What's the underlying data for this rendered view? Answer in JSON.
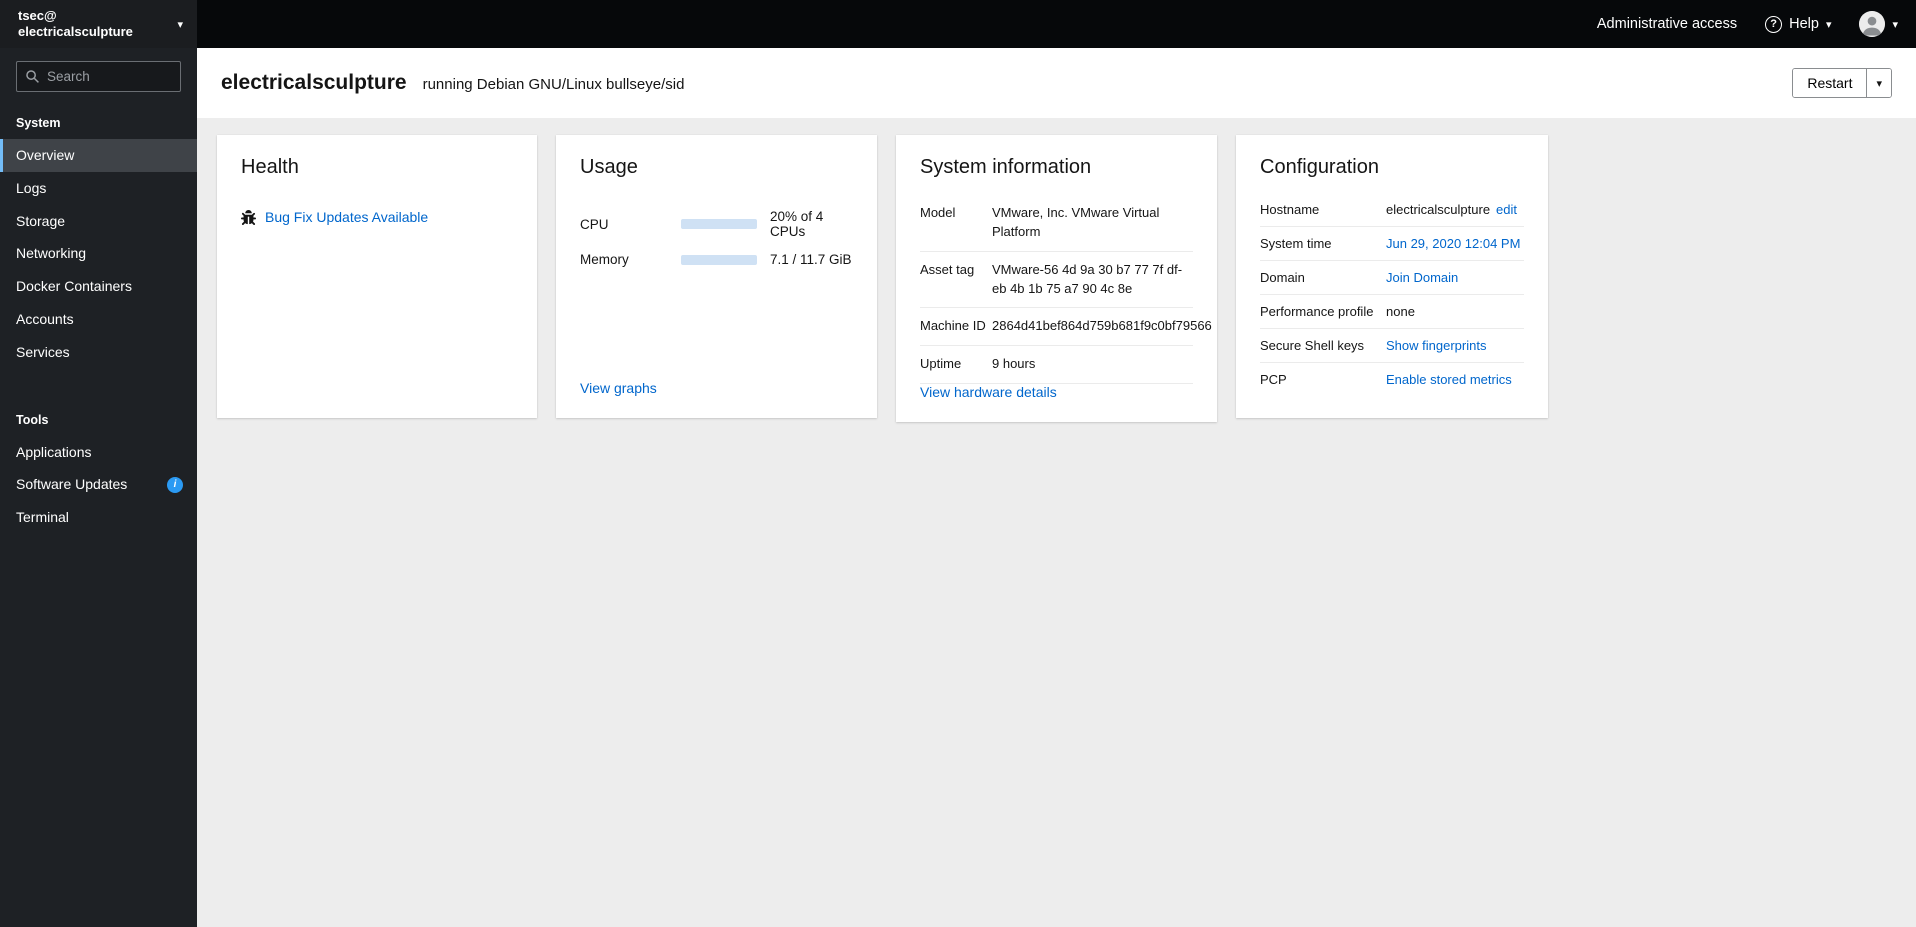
{
  "icons": {
    "chevron_down": "▾",
    "question": "?",
    "info": "i"
  },
  "sidebar": {
    "user_line1": "tsec@",
    "user_line2": "electricalsculpture",
    "search_placeholder": "Search",
    "sections": [
      {
        "label": "System",
        "items": [
          "Overview",
          "Logs",
          "Storage",
          "Networking",
          "Docker Containers",
          "Accounts",
          "Services"
        ]
      },
      {
        "label": "Tools",
        "items": [
          "Applications",
          "Software Updates",
          "Terminal"
        ]
      }
    ]
  },
  "masthead": {
    "admin_access": "Administrative access",
    "help_label": "Help"
  },
  "header": {
    "hostname": "electricalsculpture",
    "os_text": "running Debian GNU/Linux bullseye/sid",
    "restart_label": "Restart"
  },
  "cards": {
    "health": {
      "title": "Health",
      "update_link": "Bug Fix Updates Available"
    },
    "usage": {
      "title": "Usage",
      "cpu_label": "CPU",
      "cpu_value": "20% of 4 CPUs",
      "cpu_bar_style": "width:20%",
      "memory_label": "Memory",
      "memory_value": "7.1 / 11.7 GiB",
      "memory_bar_style": "width:61%",
      "view_graphs_link": "View graphs"
    },
    "system_information": {
      "title": "System information",
      "rows": [
        {
          "label": "Model",
          "value": "VMware, Inc. VMware Virtual Platform"
        },
        {
          "label": "Asset tag",
          "value": "VMware-56 4d 9a 30 b7 77 7f df-eb 4b 1b 75 a7 90 4c 8e"
        },
        {
          "label": "Machine ID",
          "value": "2864d41bef864d759b681f9c0bf79566"
        },
        {
          "label": "Uptime",
          "value": "9 hours"
        }
      ],
      "details_link": "View hardware details"
    },
    "configuration": {
      "title": "Configuration",
      "rows": [
        {
          "label": "Hostname",
          "value": "electricalsculpture",
          "link": "edit"
        },
        {
          "label": "System time",
          "link": "Jun 29, 2020 12:04 PM"
        },
        {
          "label": "Domain",
          "link": "Join Domain"
        },
        {
          "label": "Performance profile",
          "value": "none"
        },
        {
          "label": "Secure Shell keys",
          "link": "Show fingerprints"
        },
        {
          "label": "PCP",
          "link": "Enable stored metrics"
        }
      ]
    }
  },
  "colors": {
    "accent_link": "#0066cc",
    "nav_selected_border": "#73bcf7",
    "info_badge": "#2b9af3",
    "progress_fill": "#0066cc",
    "progress_track": "#cfe1f4"
  }
}
